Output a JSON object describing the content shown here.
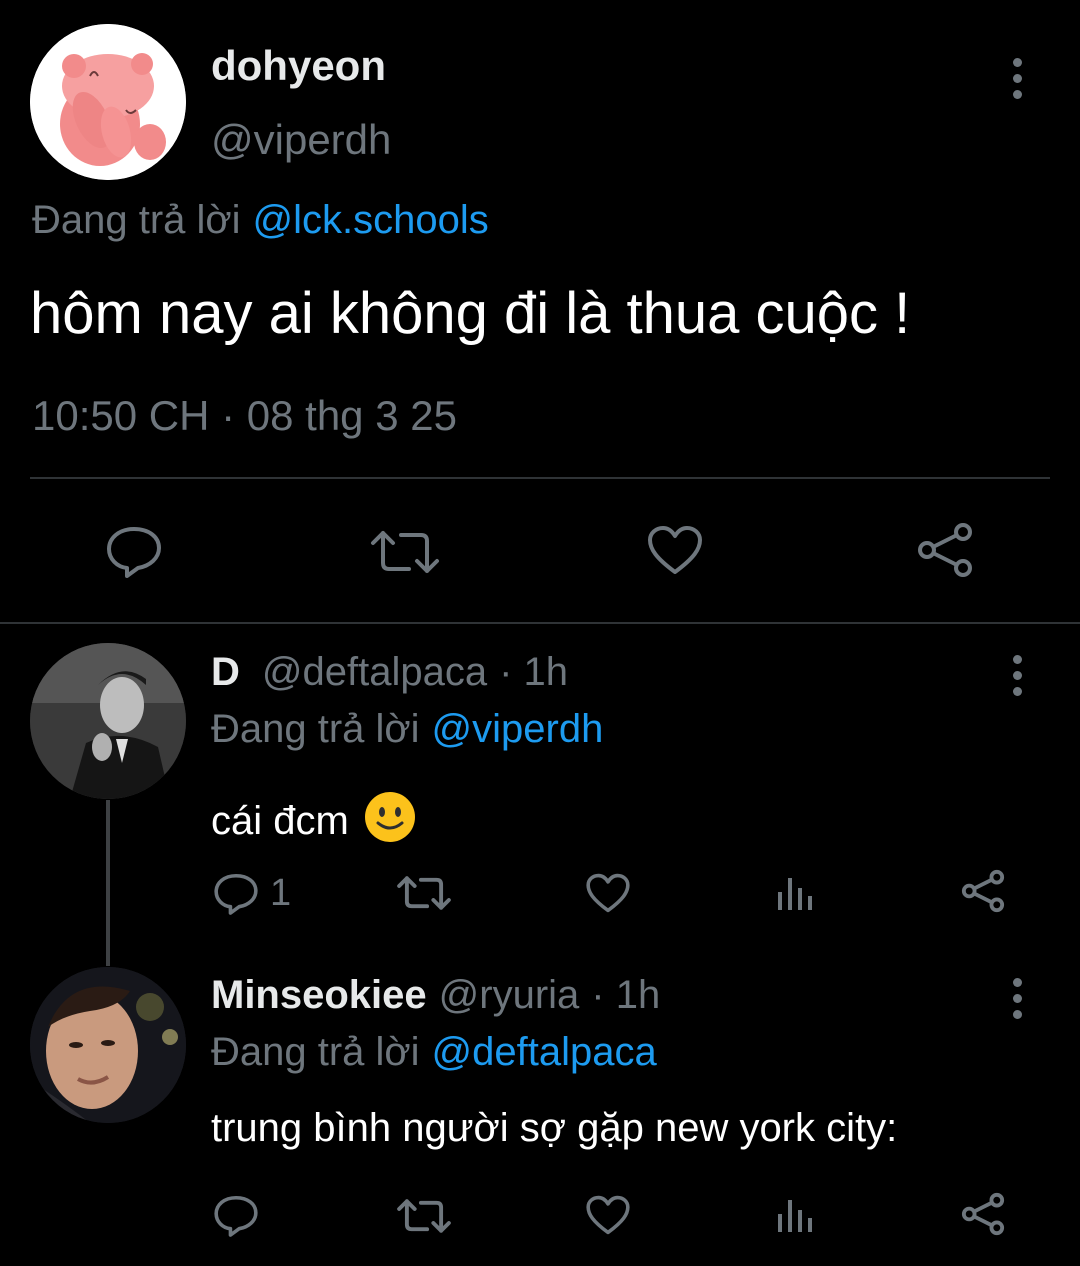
{
  "main_tweet": {
    "author_name": "dohyeon",
    "author_handle": "@viperdh",
    "reply_prefix": "Đang trả lời",
    "reply_to": "@lck.schools",
    "text": "hôm nay ai không đi là thua cuộc !",
    "timestamp": "10:50 CH · 08 thg 3 25",
    "actions": [
      "reply-icon",
      "retweet-icon",
      "like-icon",
      "share-icon"
    ]
  },
  "replies": [
    {
      "author_name": "D",
      "author_handle": "@deftalpaca",
      "time_ago": "· 1h",
      "reply_prefix": "Đang trả lời",
      "reply_to": "@viperdh",
      "text": "cái đcm",
      "emoji": "🙂",
      "reply_count": "1",
      "actions": [
        "reply-icon",
        "retweet-icon",
        "like-icon",
        "views-icon",
        "share-icon"
      ]
    },
    {
      "author_name": "Minseokiee",
      "author_handle": "@ryuria",
      "time_ago": "· 1h",
      "reply_prefix": "Đang trả lời",
      "reply_to": "@deftalpaca",
      "text": "trung bình người sợ gặp new york city:",
      "actions": [
        "reply-icon",
        "retweet-icon",
        "like-icon",
        "views-icon",
        "share-icon"
      ]
    }
  ],
  "colors": {
    "background": "#000000",
    "text": "#e7e9ea",
    "muted": "#6e767d",
    "link": "#1d9bf0",
    "divider": "#2f3336",
    "avatar_pink": "#f28b8b"
  }
}
